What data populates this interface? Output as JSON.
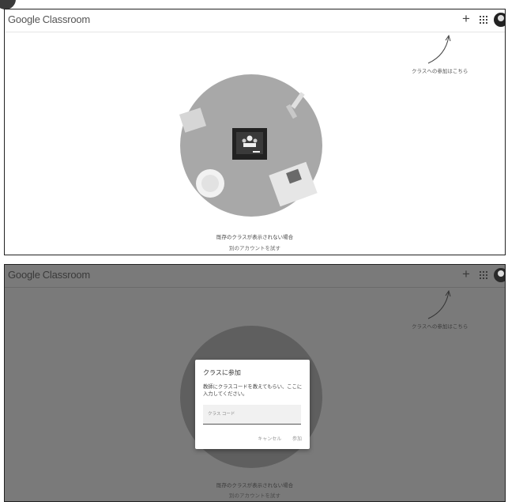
{
  "app": {
    "brand_google": "Google",
    "brand_product": "Classroom"
  },
  "toolbar": {
    "add_label": "+"
  },
  "hint": {
    "text": "クラスへの参加はこちら"
  },
  "empty_state": {
    "message": "既存のクラスが表示されない場合",
    "switch_account": "別のアカウントを試す"
  },
  "join_dialog": {
    "title": "クラスに参加",
    "description": "教師にクラスコードを教えてもらい、ここに入力してください。",
    "code_placeholder": "クラス コード",
    "cancel_label": "キャンセル",
    "join_label": "参加"
  },
  "icons": {
    "add": "plus-icon",
    "apps": "apps-grid-icon",
    "account": "account-avatar-icon"
  },
  "colors": {
    "overlay": "#7a7a7a",
    "illustration_circle": "#a8a8a8",
    "board": "#222222"
  }
}
